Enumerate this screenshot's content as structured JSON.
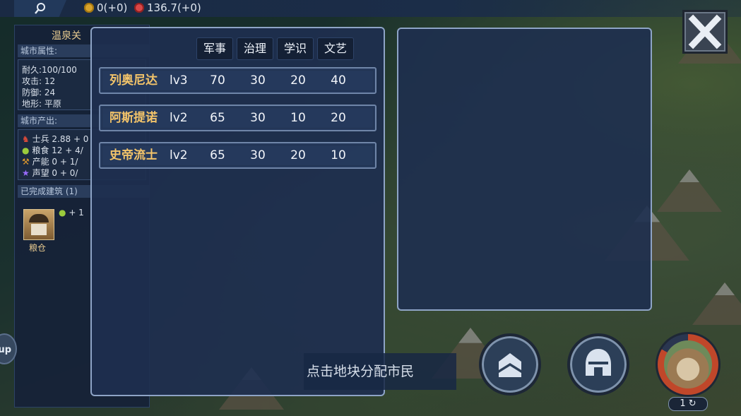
{
  "top_bar": {
    "coins_text": "0(+0)",
    "time_text": "136.7(+0)",
    "icons": [
      "search-icon",
      "coin-icon",
      "alarm-clock-icon"
    ]
  },
  "city_panel": {
    "title": "温泉关",
    "attributes_header": "城市属性:",
    "durability": "耐久:100/100",
    "attack": "攻击: 12",
    "defense": "防御: 24",
    "terrain": "地形: 平原",
    "output_header": "城市产出:",
    "soldiers": "士兵 2.88 + 0",
    "food": "粮食 12 + 4/",
    "production": "产能 0 + 1/",
    "prestige": "声望 0 + 0/",
    "buildings_header": "已完成建筑 (1)",
    "building_bonus": "+ 1",
    "building_name": "粮仓"
  },
  "table": {
    "headers": [
      "军事",
      "治理",
      "学识",
      "文艺"
    ],
    "rows": [
      {
        "name": "列奥尼达",
        "level": "lv3",
        "military": "70",
        "governance": "30",
        "knowledge": "20",
        "arts": "40"
      },
      {
        "name": "阿斯提诺",
        "level": "lv2",
        "military": "65",
        "governance": "30",
        "knowledge": "10",
        "arts": "20"
      },
      {
        "name": "史帝流士",
        "level": "lv2",
        "military": "65",
        "governance": "30",
        "knowledge": "20",
        "arts": "10"
      }
    ]
  },
  "bottom": {
    "hint": "点击地块分配市民",
    "queue_count": "1",
    "left_button_label": "up"
  },
  "colors": {
    "panel_bg": "#1e2f4f",
    "panel_border": "#8ea4c6",
    "name_gold": "#f3c46a",
    "header_bg": "#142035"
  }
}
